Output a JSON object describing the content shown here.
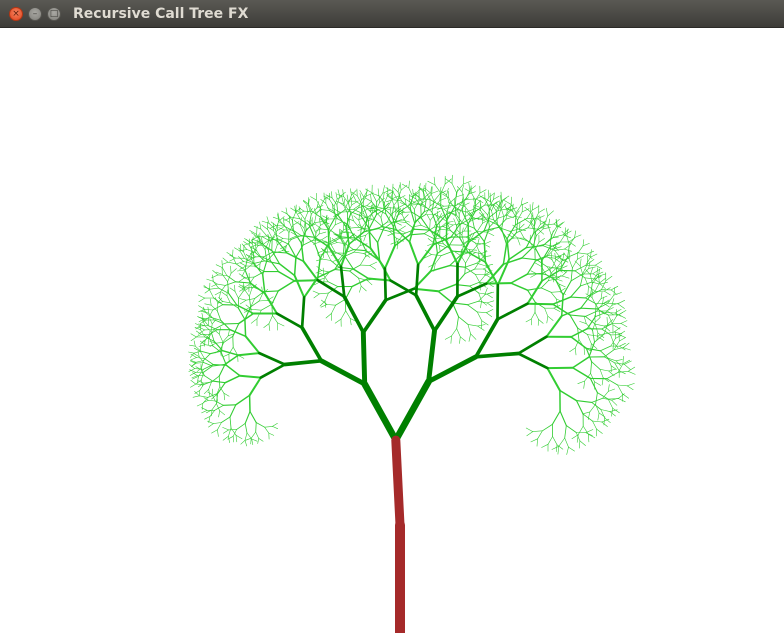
{
  "window": {
    "title": "Recursive Call Tree FX",
    "close_glyph": "×",
    "minimize_glyph": "–",
    "maximize_glyph": "□"
  },
  "colors": {
    "titlebar": "#4a4945",
    "trunk": "#a52a2a",
    "branch_dark": "#008000",
    "leaf_light": "#32cd32",
    "background": "#ffffff"
  },
  "icons": {
    "close": "close-icon",
    "minimize": "minimize-icon",
    "maximize": "maximize-icon"
  }
}
